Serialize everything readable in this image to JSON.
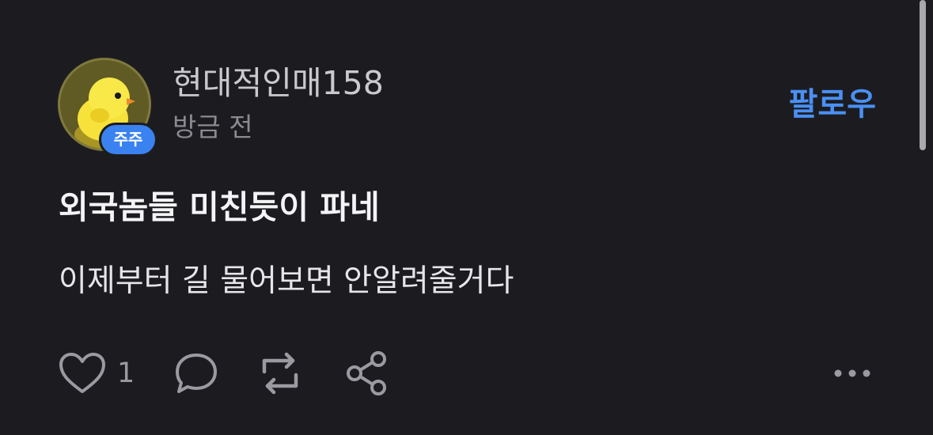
{
  "post": {
    "author": {
      "username": "현대적인매158",
      "badge": "주주",
      "avatar_icon": "chick-icon"
    },
    "timestamp": "방금 전",
    "follow_label": "팔로우",
    "title": "외국놈들 미친듯이 파네",
    "body": "이제부터 길 물어보면 안알려줄거다",
    "actions": {
      "like_count": "1",
      "like_icon": "heart-icon",
      "comment_icon": "comment-bubble-icon",
      "repost_icon": "repost-icon",
      "share_icon": "share-icon",
      "more_icon": "more-dots-icon"
    }
  },
  "colors": {
    "background": "#1c1c20",
    "accent": "#4a90f5",
    "badge": "#3a82f0"
  }
}
